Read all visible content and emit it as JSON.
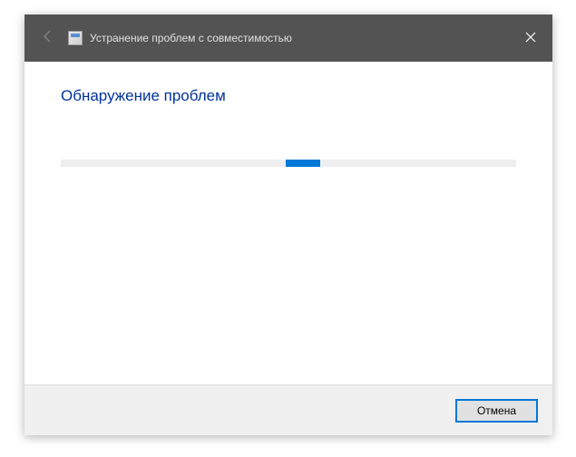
{
  "titlebar": {
    "title": "Устранение проблем с совместимостью"
  },
  "content": {
    "heading": "Обнаружение проблем"
  },
  "footer": {
    "cancel_label": "Отмена"
  }
}
